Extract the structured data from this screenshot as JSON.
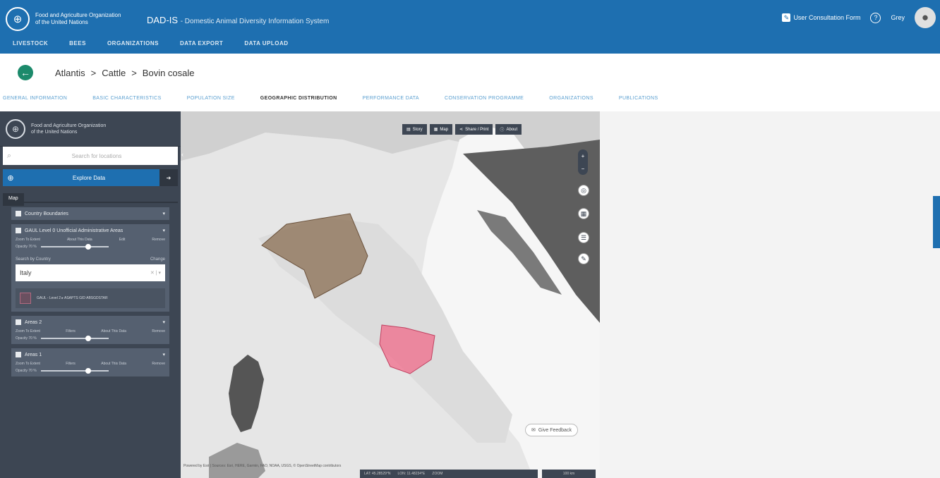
{
  "header": {
    "org_line1": "Food and Agriculture Organization",
    "org_line2": "of the United Nations",
    "app_code": "DAD-IS",
    "app_subtitle": "- Domestic Animal Diversity Information System",
    "nav": [
      "LIVESTOCK",
      "BEES",
      "ORGANIZATIONS",
      "DATA EXPORT",
      "DATA UPLOAD"
    ],
    "consultation_label": "User Consultation Form",
    "user_name": "Grey"
  },
  "breadcrumb": {
    "country": "Atlantis",
    "species": "Cattle",
    "breed": "Bovin cosale",
    "sep": ">"
  },
  "tabs": [
    "GENERAL INFORMATION",
    "BASIC CHARACTERISTICS",
    "POPULATION SIZE",
    "GEOGRAPHIC DISTRIBUTION",
    "PERFORMANCE DATA",
    "CONSERVATION PROGRAMME",
    "ORGANIZATIONS",
    "PUBLICATIONS"
  ],
  "sidebar": {
    "org_line1": "Food and Agriculture Organization",
    "org_line2": "of the United Nations",
    "search_placeholder": "Search for locations",
    "explore_label": "Explore Data",
    "map_tab": "Map",
    "layers": [
      {
        "title": "Country Boundaries"
      },
      {
        "title": "GAUL Level 0 Unofficial Administrative Areas",
        "zoom": "Zoom To Extent",
        "about": "About This Data",
        "edit": "Edit",
        "remove": "Remove",
        "opacity": "Opacity 70 %",
        "opacity_value": 0.7
      },
      {
        "title": "Areas 2",
        "zoom": "Zoom To Extent",
        "about": "About This Data",
        "remove": "Remove",
        "filter": "Filters",
        "opacity": "Opacity 70 %",
        "opacity_value": 0.7
      },
      {
        "title": "Areas 1",
        "zoom": "Zoom To Extent",
        "about": "About This Data",
        "remove": "Remove",
        "filter": "Filters",
        "opacity": "Opacity 70 %",
        "opacity_value": 0.7
      }
    ],
    "search_by": "Search by Country",
    "change": "Change",
    "country_value": "Italy",
    "legend_text": "GAUL - Level 2 ▸ ASAPTS GID  ABSGDSTAR"
  },
  "map": {
    "buttons": [
      "Story",
      "Map",
      "Share / Print",
      "About"
    ],
    "feedback": "Give Feedback",
    "attribution": "Powered by Esri | Sources: Esri, HERE, Garmin, FAO, NOAA, USGS, © OpenStreetMap contributors",
    "coords": {
      "lat": "LAT: 45.28529°N",
      "lon": "LON: 11.48234°E",
      "zoom": "ZOOM"
    },
    "scale": "100 km"
  },
  "colors": {
    "primary": "#1e6fb0",
    "sidebar": "#3d4653",
    "area_brown": "#8a6d52",
    "area_pink": "#f06b8a"
  }
}
